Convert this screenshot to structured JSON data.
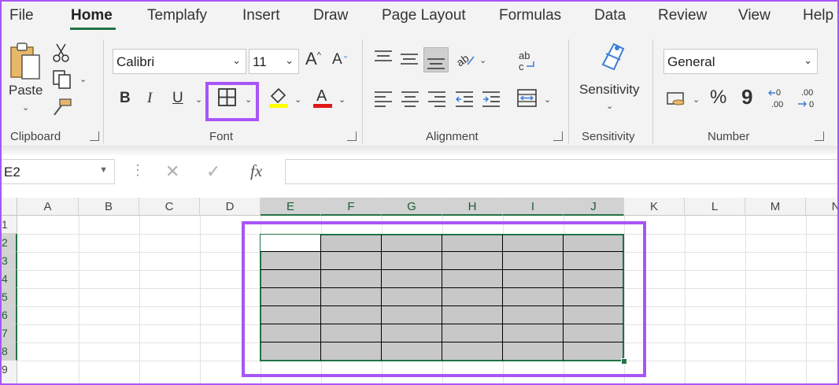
{
  "menu": {
    "tabs": [
      "File",
      "Home",
      "Templafy",
      "Insert",
      "Draw",
      "Page Layout",
      "Formulas",
      "Data",
      "Review",
      "View",
      "Help"
    ],
    "active_tab": "Home"
  },
  "ribbon": {
    "clipboard": {
      "paste_label": "Paste",
      "group_label": "Clipboard"
    },
    "font": {
      "font_name": "Calibri",
      "font_size": "11",
      "group_label": "Font",
      "bold": "B",
      "italic": "I",
      "underline": "U",
      "grow": "A",
      "shrink": "A"
    },
    "alignment": {
      "group_label": "Alignment"
    },
    "sensitivity": {
      "button_label": "Sensitivity",
      "group_label": "Sensitivity"
    },
    "number": {
      "format": "General",
      "group_label": "Number",
      "percent": "%",
      "comma": "9"
    }
  },
  "formula_bar": {
    "name_box": "E2",
    "fx": "fx",
    "value": ""
  },
  "sheet": {
    "columns": [
      "A",
      "B",
      "C",
      "D",
      "E",
      "F",
      "G",
      "H",
      "I",
      "J",
      "K",
      "L",
      "M",
      "N"
    ],
    "selected_columns": [
      "E",
      "F",
      "G",
      "H",
      "I",
      "J"
    ],
    "rows": [
      "1",
      "2",
      "3",
      "4",
      "5",
      "6",
      "7",
      "8",
      "9"
    ],
    "selected_rows": [
      "2",
      "3",
      "4",
      "5",
      "6",
      "7",
      "8"
    ],
    "selection": "E2:J8"
  },
  "colors": {
    "accent": "#217346",
    "highlight": "#a855f7",
    "selection_fill": "#c8c8c8"
  },
  "icons": [
    "paste-icon",
    "cut-icon",
    "copy-icon",
    "format-painter-icon",
    "borders-icon",
    "fill-color-icon",
    "font-color-icon",
    "wrap-text-icon",
    "merge-center-icon",
    "sensitivity-icon",
    "accounting-format-icon",
    "increase-decimal-icon",
    "decrease-decimal-icon"
  ]
}
